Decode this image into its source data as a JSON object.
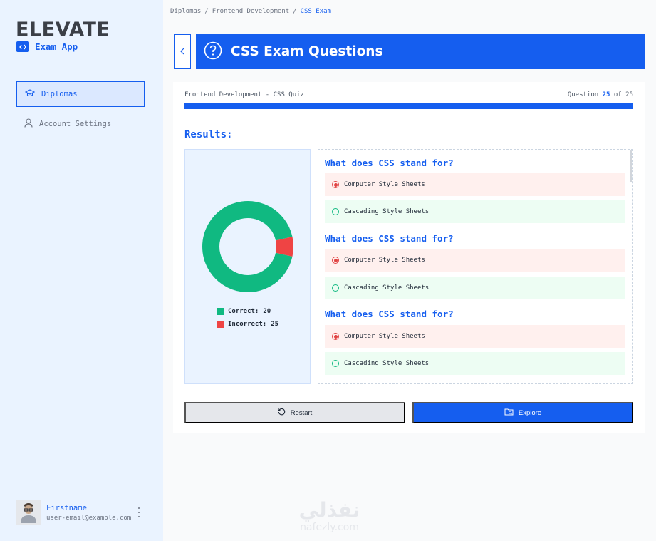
{
  "sidebar": {
    "brand": "ELEVATE",
    "app_name": "Exam App",
    "nav": [
      {
        "label": "Diplomas",
        "icon": "graduation-cap-icon",
        "active": true
      },
      {
        "label": "Account Settings",
        "icon": "user-icon",
        "active": false
      }
    ],
    "user": {
      "name": "Firstname",
      "email": "user-email@example.com"
    }
  },
  "breadcrumb": {
    "items": [
      "Diplomas",
      "Frontend Development"
    ],
    "separator": "/",
    "current": "CSS Exam"
  },
  "header": {
    "title": "CSS Exam Questions"
  },
  "quiz": {
    "name": "Frontend Development - CSS Quiz",
    "question_prefix": "Question",
    "current": "25",
    "of_label": "of",
    "total": "25",
    "progress": 1.0
  },
  "results": {
    "label": "Results:",
    "legend": [
      {
        "label": "Correct:",
        "value": "20"
      },
      {
        "label": "Incorrect:",
        "value": "25"
      }
    ]
  },
  "chart_data": {
    "type": "pie",
    "donut": true,
    "categories": [
      "Correct",
      "Incorrect"
    ],
    "values": [
      20,
      25
    ],
    "colors": [
      "#10b981",
      "#ef4444"
    ],
    "note": "rendered proportions show incorrect slice as small wedge"
  },
  "questions": [
    {
      "text": "What does CSS stand for?",
      "selected": "Computer Style Sheets",
      "correct": "Cascading Style Sheets"
    },
    {
      "text": "What does CSS stand for?",
      "selected": "Computer Style Sheets",
      "correct": "Cascading Style Sheets"
    },
    {
      "text": "What does CSS stand for?",
      "selected": "Computer Style Sheets",
      "correct": "Cascading Style Sheets"
    }
  ],
  "actions": {
    "restart": "Restart",
    "explore": "Explore"
  },
  "watermark": {
    "arabic": "نفذلي",
    "latin": "nafezly.com"
  },
  "colors": {
    "accent": "#155eef",
    "correct": "#10b981",
    "incorrect": "#ef4444",
    "sidebar_bg": "#eaf3ff"
  }
}
